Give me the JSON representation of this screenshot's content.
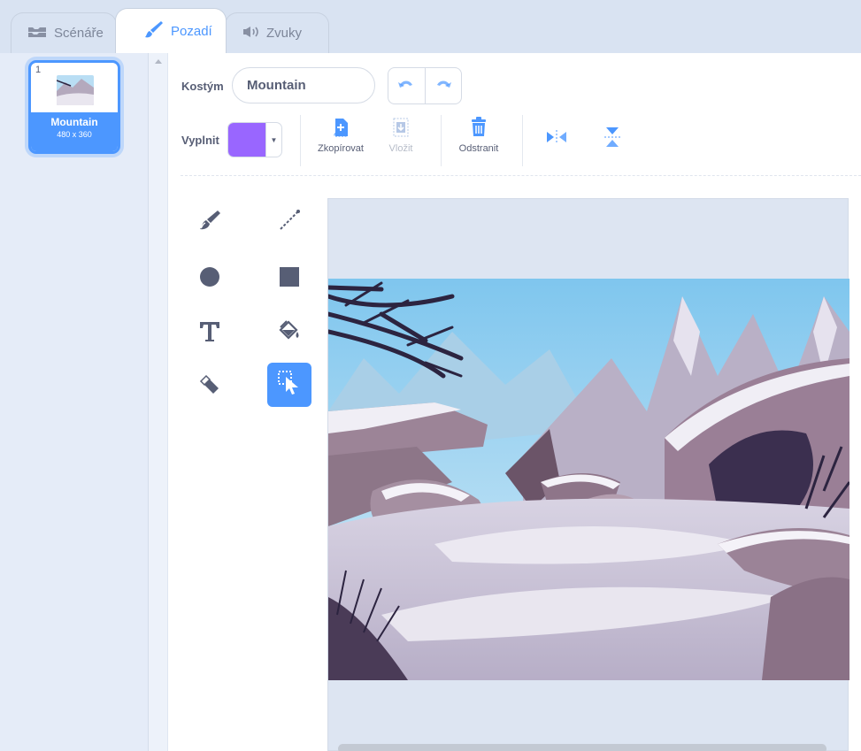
{
  "tabs": {
    "scripts": "Scénáře",
    "backdrop": "Pozadí",
    "sounds": "Zvuky"
  },
  "costumes": [
    {
      "index": "1",
      "name": "Mountain",
      "size": "480 x 360"
    }
  ],
  "editor": {
    "costume_label": "Kostým",
    "costume_name": "Mountain",
    "fill_label": "Vyplnit",
    "fill_color": "#9966ff",
    "actions": {
      "copy": "Zkopírovat",
      "paste": "Vložit",
      "delete": "Odstranit"
    }
  },
  "colors": {
    "accent": "#4c97ff",
    "text": "#575e75",
    "disabled": "#b6bcc8"
  },
  "icons": {
    "scripts": "code-blocks-icon",
    "backdrop": "paintbrush-icon",
    "sounds": "speaker-icon",
    "tools": [
      "brush-icon",
      "line-icon",
      "circle-icon",
      "rectangle-icon",
      "text-icon",
      "fill-bucket-icon",
      "eraser-icon",
      "select-icon"
    ]
  }
}
